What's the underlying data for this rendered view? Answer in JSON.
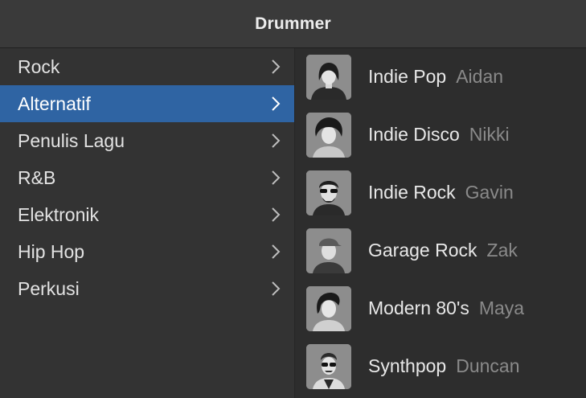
{
  "window": {
    "title": "Drummer"
  },
  "genres": [
    {
      "label": "Rock",
      "selected": false
    },
    {
      "label": "Alternatif",
      "selected": true
    },
    {
      "label": "Penulis Lagu",
      "selected": false
    },
    {
      "label": "R&B",
      "selected": false
    },
    {
      "label": "Elektronik",
      "selected": false
    },
    {
      "label": "Hip Hop",
      "selected": false
    },
    {
      "label": "Perkusi",
      "selected": false
    }
  ],
  "drummers": [
    {
      "style": "Indie Pop",
      "name": "Aidan",
      "icon": "drummer-aidan-icon"
    },
    {
      "style": "Indie Disco",
      "name": "Nikki",
      "icon": "drummer-nikki-icon"
    },
    {
      "style": "Indie Rock",
      "name": "Gavin",
      "icon": "drummer-gavin-icon"
    },
    {
      "style": "Garage Rock",
      "name": "Zak",
      "icon": "drummer-zak-icon"
    },
    {
      "style": "Modern 80's",
      "name": "Maya",
      "icon": "drummer-maya-icon"
    },
    {
      "style": "Synthpop",
      "name": "Duncan",
      "icon": "drummer-duncan-icon"
    }
  ],
  "colors": {
    "selection": "#2f64a3",
    "accent_text": "#e8e8e8",
    "muted_text": "#8a8a8a"
  }
}
